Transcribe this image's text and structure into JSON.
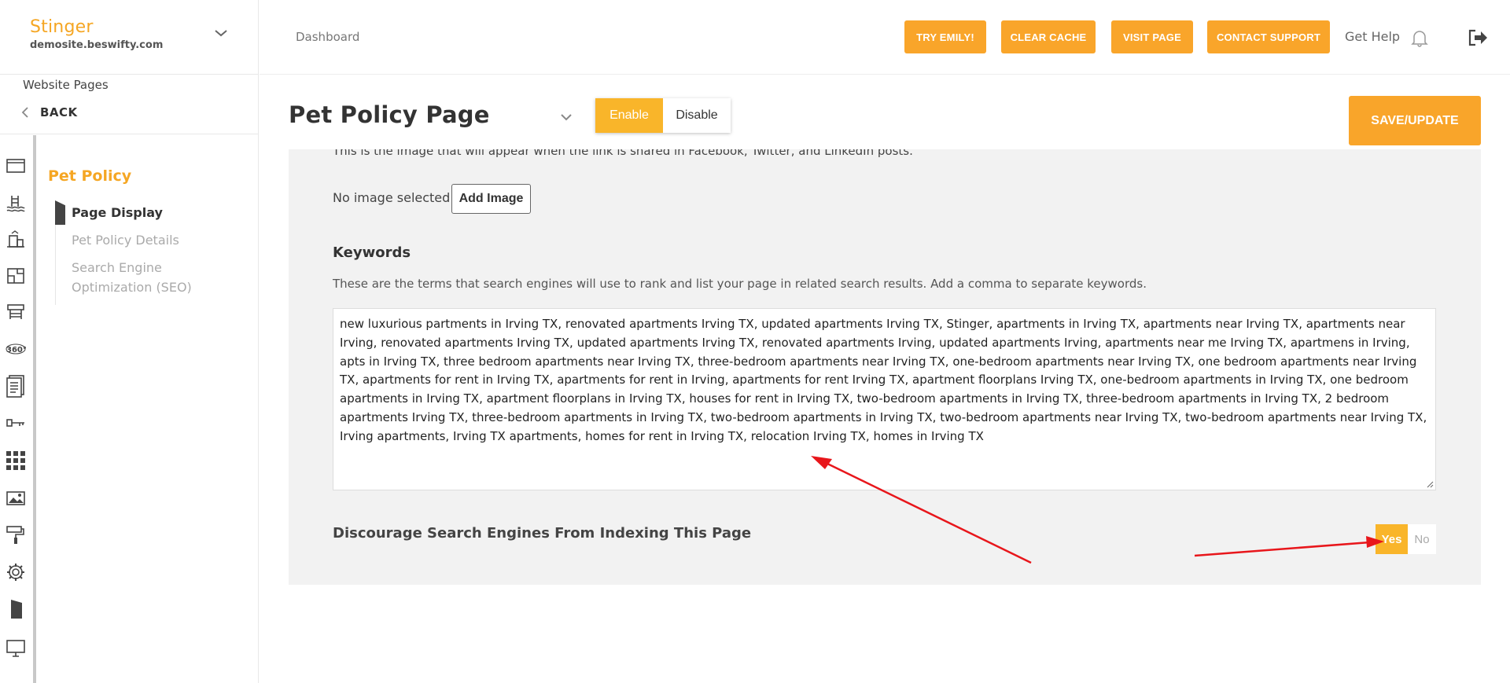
{
  "brand": {
    "name": "Stinger",
    "domain": "demosite.beswifty.com"
  },
  "sidebar": {
    "section": "Website Pages",
    "back_label": "BACK",
    "icons": [
      "browser-window-icon",
      "pool-icon",
      "building-icon",
      "floorplan-icon",
      "amenities-icon",
      "360-tour-icon",
      "document-icon",
      "key-icon",
      "grid-apps-icon",
      "gallery-image-icon",
      "paint-roller-icon",
      "settings-gear-icon",
      "flag-icon",
      "monitor-icon"
    ],
    "page_title": "Pet Policy",
    "items": [
      {
        "label": "Page Display",
        "active": true
      },
      {
        "label": "Pet Policy Details",
        "active": false
      },
      {
        "label": "Search Engine Optimization (SEO)",
        "active": false
      }
    ]
  },
  "topbar": {
    "breadcrumb": "Dashboard",
    "buttons": {
      "try_emily": "TRY EMILY!",
      "clear_cache": "CLEAR CACHE",
      "visit_page": "VISIT PAGE",
      "contact_support": "CONTACT SUPPORT"
    },
    "get_help": "Get Help"
  },
  "header": {
    "title": "Pet Policy Page",
    "enable_label": "Enable",
    "disable_label": "Disable",
    "save_label": "SAVE/UPDATE"
  },
  "content": {
    "share_image_help": "This is the image that will appear when the link is shared in Facebook, Twitter, and LinkedIn posts.",
    "no_image": "No image selected",
    "add_image": "Add Image",
    "keywords_label": "Keywords",
    "keywords_help": "These are the terms that search engines will use to rank and list your page in related search results. Add a comma to separate keywords.",
    "keywords_value": "new luxurious partments in Irving TX, renovated apartments Irving TX, updated apartments Irving TX, Stinger, apartments in Irving TX, apartments near Irving TX, apartments near Irving, renovated apartments Irving TX, updated apartments Irving TX, renovated apartments Irving, updated apartments Irving, apartments near me Irving TX, apartmens in Irving, apts in Irving TX, three bedroom apartments near Irving TX, three-bedroom apartments near Irving TX, one-bedroom apartments near Irving TX, one bedroom apartments near Irving TX, apartments for rent in Irving TX, apartments for rent in Irving, apartments for rent Irving TX, apartment floorplans Irving TX, one-bedroom apartments in Irving TX, one bedroom apartments in Irving TX, apartment floorplans in Irving TX, houses for rent in Irving TX, two-bedroom apartments in Irving TX, three-bedroom apartments in Irving TX, 2 bedroom apartments Irving TX, three-bedroom apartments in Irving TX, two-bedroom apartments in Irving TX, two-bedroom apartments near Irving TX, two-bedroom apartments near Irving TX, Irving apartments, Irving TX apartments, homes for rent in Irving TX, relocation Irving TX, homes in Irving TX",
    "discourage_label": "Discourage Search Engines From Indexing This Page",
    "yes_label": "Yes",
    "no_label": "No",
    "discourage_value": "Yes"
  },
  "colors": {
    "accent": "#f9a52a",
    "brand": "#f5a623",
    "annotation_arrow": "#e8161b"
  }
}
